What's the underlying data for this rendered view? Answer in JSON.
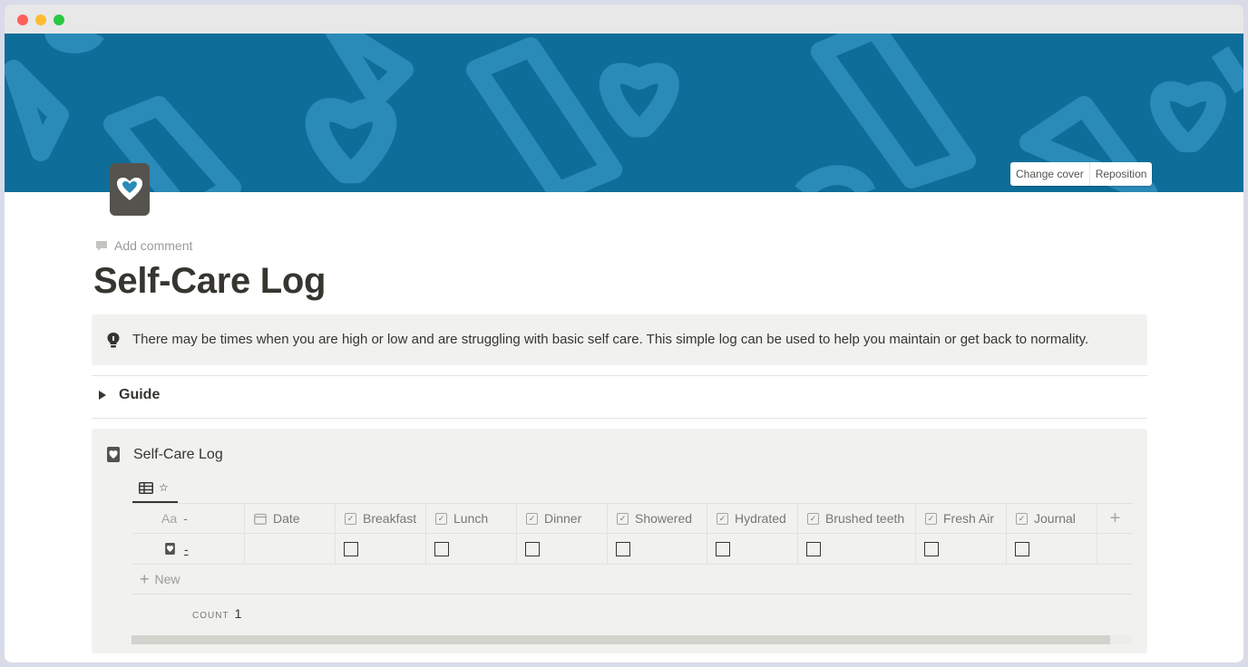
{
  "cover": {
    "change_cover_label": "Change cover",
    "reposition_label": "Reposition",
    "color": "#0f6e99"
  },
  "page": {
    "add_comment_label": "Add comment",
    "title": "Self-Care Log",
    "icon": "heart-card-icon"
  },
  "callout": {
    "icon": "lightbulb-icon",
    "text": "There may be times when you are high or low and are struggling with basic self care. This simple log can be used to help you maintain or get back to normality."
  },
  "toggle": {
    "label": "Guide"
  },
  "database": {
    "title": "Self-Care Log",
    "view_icon": "table-icon",
    "view_star": "☆",
    "columns": {
      "name": {
        "icon": "Aa",
        "label": "-"
      },
      "date": {
        "label": "Date"
      },
      "breakfast": {
        "label": "Breakfast"
      },
      "lunch": {
        "label": "Lunch"
      },
      "dinner": {
        "label": "Dinner"
      },
      "showered": {
        "label": "Showered"
      },
      "hydrated": {
        "label": "Hydrated"
      },
      "brushed_teeth": {
        "label": "Brushed teeth"
      },
      "fresh_air": {
        "label": "Fresh Air"
      },
      "journal": {
        "label": "Journal"
      }
    },
    "rows": [
      {
        "name": "-",
        "date": "",
        "breakfast": false,
        "lunch": false,
        "dinner": false,
        "showered": false,
        "hydrated": false,
        "brushed_teeth": false,
        "fresh_air": false,
        "journal": false
      }
    ],
    "new_label": "New",
    "count_label": "COUNT",
    "count_value": "1"
  }
}
